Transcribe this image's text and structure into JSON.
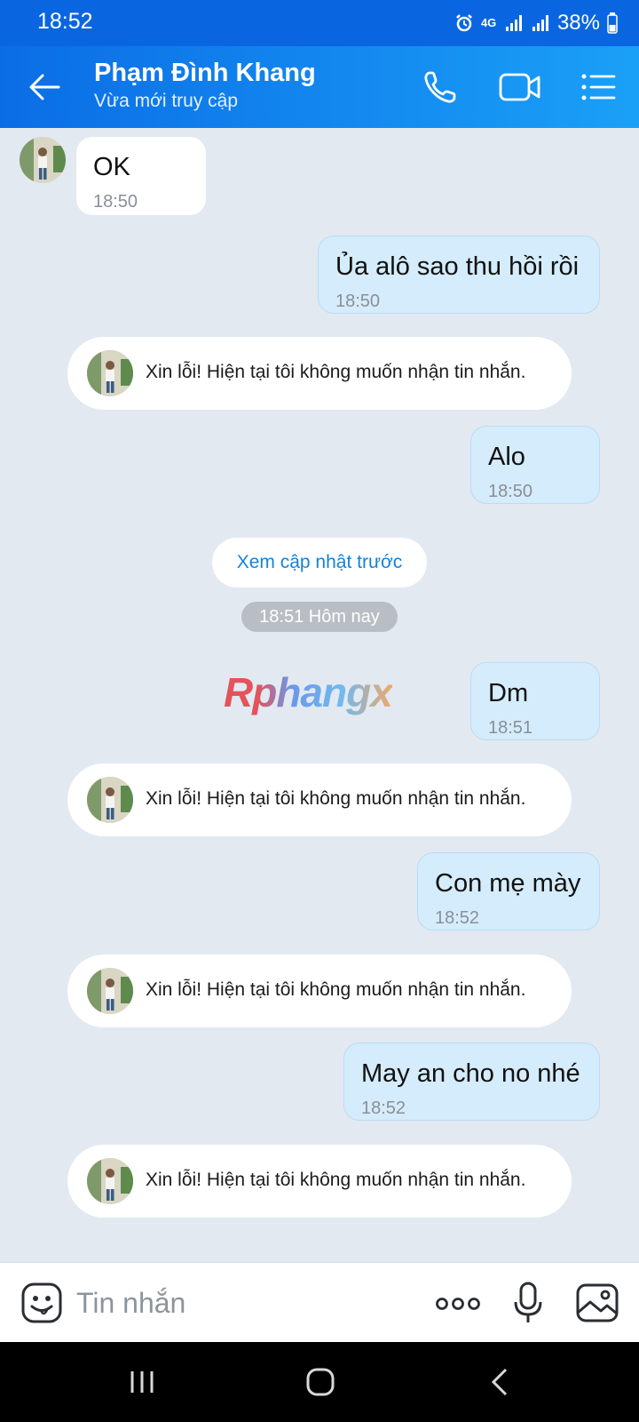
{
  "status_bar": {
    "time": "18:52",
    "network": "4G",
    "battery": "38%"
  },
  "header": {
    "contact_name": "Phạm Đình Khang",
    "contact_status": "Vừa mới truy cập",
    "icons": [
      "back-arrow-icon",
      "phone-icon",
      "video-camera-icon",
      "menu-list-icon"
    ]
  },
  "messages": [
    {
      "direction": "in",
      "text": "OK",
      "time": "18:50"
    },
    {
      "direction": "out",
      "text": "Ủa alô sao thu hồi rồi",
      "time": "18:50"
    },
    {
      "direction": "auto",
      "text": "Xin lỗi! Hiện tại tôi không muốn nhận tin nhắn."
    },
    {
      "direction": "out",
      "text": "Alo",
      "time": "18:50"
    },
    {
      "direction": "out",
      "text": "Dm",
      "time": "18:51"
    },
    {
      "direction": "auto",
      "text": "Xin lỗi! Hiện tại tôi không muốn nhận tin nhắn."
    },
    {
      "direction": "out",
      "text": "Con mẹ mày",
      "time": "18:52"
    },
    {
      "direction": "auto",
      "text": "Xin lỗi! Hiện tại tôi không muốn nhận tin nhắn."
    },
    {
      "direction": "out",
      "text": "May an cho no nhé",
      "time": "18:52"
    },
    {
      "direction": "auto",
      "text": "Xin lỗi! Hiện tại tôi không muốn nhận tin nhắn."
    }
  ],
  "prev_updates_label": "Xem cập nhật trước",
  "date_separator": "18:51 Hôm nay",
  "watermark": "Rphangx",
  "input_bar": {
    "placeholder": "Tin nhắn",
    "icons": [
      "sticker-icon",
      "more-icon",
      "microphone-icon",
      "image-icon"
    ]
  },
  "colors": {
    "header_start": "#0b6de6",
    "header_end": "#1aa0f7",
    "chat_background": "#e2e9f1",
    "outgoing_bubble": "#d4ecfb",
    "incoming_bubble": "#ffffff",
    "link": "#1483d7"
  }
}
